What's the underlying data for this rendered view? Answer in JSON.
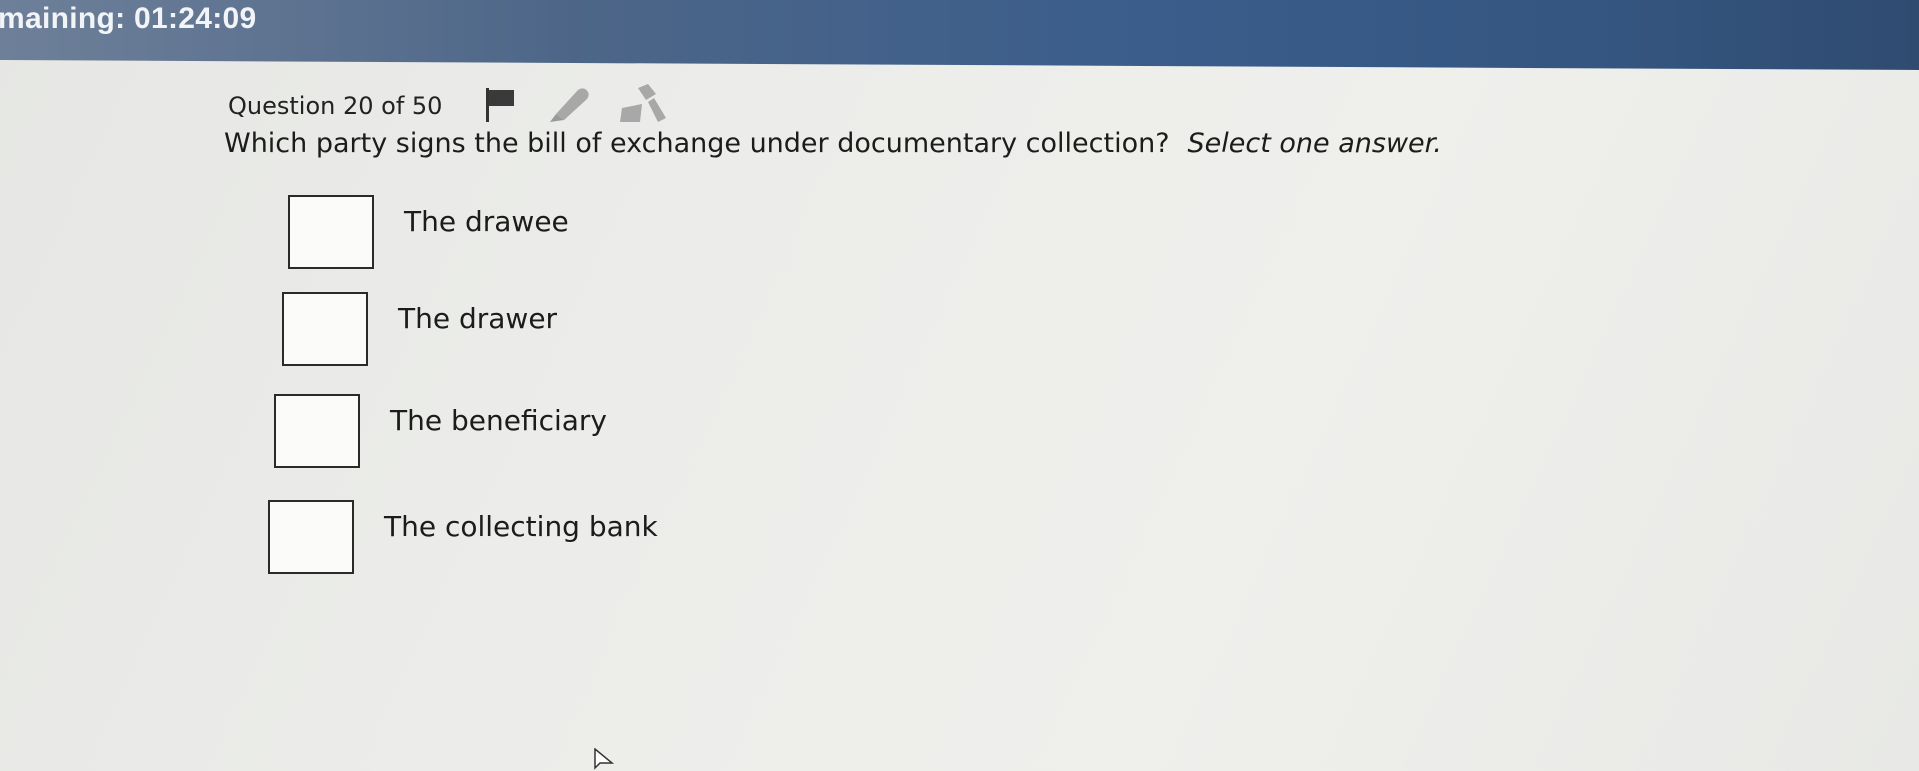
{
  "header": {
    "timer_text": "maining: 01:24:09"
  },
  "question": {
    "counter": "Question 20 of 50",
    "text": "Which party signs the bill of exchange under documentary collection?",
    "instruction": "Select one answer."
  },
  "toolbar": {
    "icons": [
      "flag-icon",
      "highlighter-icon",
      "eraser-icon"
    ]
  },
  "answers": [
    {
      "label": "The drawee",
      "checked": false
    },
    {
      "label": "The drawer",
      "checked": false
    },
    {
      "label": "The beneficiary",
      "checked": false
    },
    {
      "label": "The collecting bank",
      "checked": false
    }
  ],
  "colors": {
    "header_band": "#3a5d8b",
    "background": "#ecedea",
    "text": "#1c1c1c"
  }
}
